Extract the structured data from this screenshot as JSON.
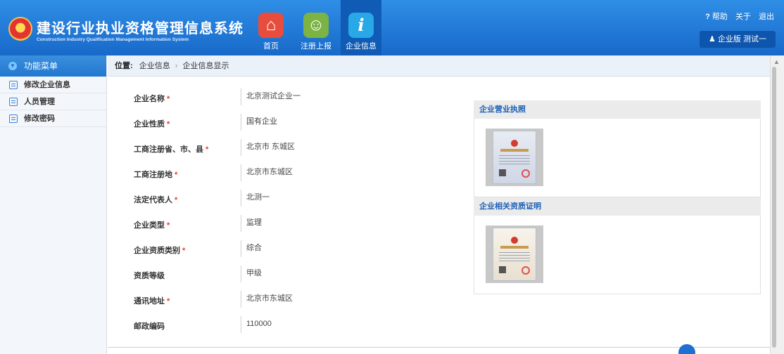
{
  "header": {
    "title": "建设行业执业资格管理信息系统",
    "subtitle": "Construction Industry Qualification Management Information System",
    "nav": [
      {
        "label": "首页",
        "icon": "home-icon",
        "color": "#e74c3c"
      },
      {
        "label": "注册上报",
        "icon": "user-search-icon",
        "color": "#7cb342"
      },
      {
        "label": "企业信息",
        "icon": "info-icon",
        "color": "#29a8e8"
      }
    ],
    "links": {
      "help": "帮助",
      "about": "关于",
      "logout": "退出",
      "help_mark": "?"
    },
    "user": {
      "edition": "企业版",
      "name": "测试一"
    }
  },
  "sidebar": {
    "title": "功能菜单",
    "items": [
      {
        "label": "修改企业信息",
        "icon": "list-icon"
      },
      {
        "label": "人员管理",
        "icon": "list-icon"
      },
      {
        "label": "修改密码",
        "icon": "message-icon"
      }
    ]
  },
  "breadcrumb": {
    "label": "位置:",
    "items": [
      "企业信息",
      "企业信息显示"
    ],
    "sep": "›"
  },
  "form": {
    "fields": [
      {
        "label": "企业名称",
        "required": true,
        "value": "北京测试企业一"
      },
      {
        "label": "企业性质",
        "required": true,
        "value": "国有企业"
      },
      {
        "label": "工商注册省、市、县",
        "required": true,
        "value": "北京市 东城区"
      },
      {
        "label": "工商注册地",
        "required": true,
        "value": "北京市东城区"
      },
      {
        "label": "法定代表人",
        "required": true,
        "value": "北测一"
      },
      {
        "label": "企业类型",
        "required": true,
        "value": "监理"
      },
      {
        "label": "企业资质类别",
        "required": true,
        "value": "综合"
      },
      {
        "label": "资质等级",
        "required": false,
        "value": "甲级"
      },
      {
        "label": "通讯地址",
        "required": true,
        "value": "北京市东城区"
      },
      {
        "label": "邮政编码",
        "required": false,
        "value": "110000"
      }
    ]
  },
  "panels": [
    {
      "title": "企业营业执照"
    },
    {
      "title": "企业相关资质证明"
    }
  ]
}
